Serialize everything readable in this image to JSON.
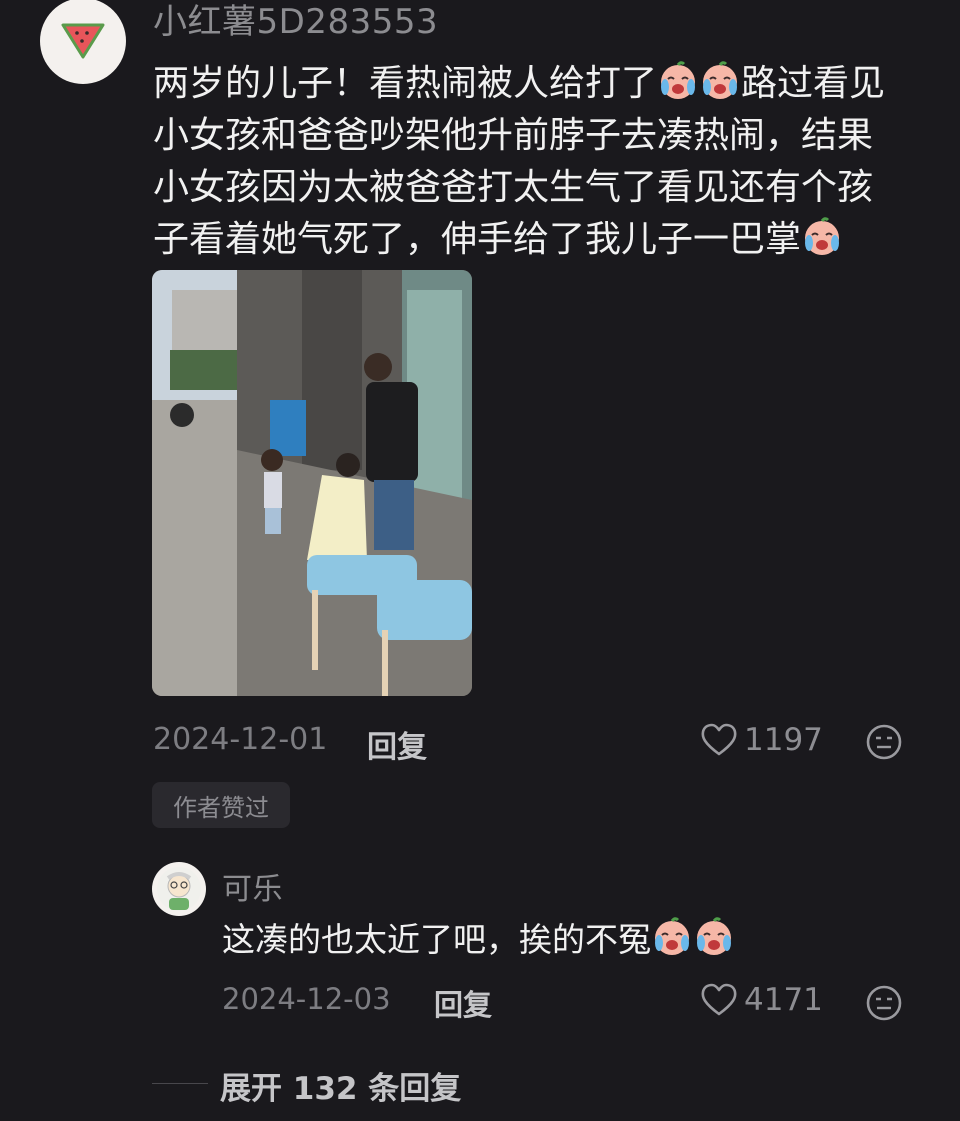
{
  "comment": {
    "username": "小红薯5D283553",
    "lines": [
      "两岁的儿子！看热闹被人给打了",
      "路过看见",
      "小女孩和爸爸吵架他升前脖子去凑热闹，结果",
      "小女孩因为太被爸爸打太生气了看见还有个孩",
      "子看着她气死了，伸手给了我儿子一巴掌"
    ],
    "date": "2024-12-01",
    "reply_label": "回复",
    "likes": "1197",
    "author_liked": "作者赞过"
  },
  "reply": {
    "username": "可乐",
    "text": "这凑的也太近了吧，挨的不冤",
    "date": "2024-12-03",
    "reply_label": "回复",
    "likes": "4171"
  },
  "expand_text": "展开 132 条回复",
  "icons": {
    "avatar_main": "watermelon-icon",
    "emoji": "crying-face-emoji",
    "like": "heart-outline-icon",
    "reaction": "neutral-face-icon"
  },
  "colors": {
    "background": "#1a191d",
    "text": "#f1f1f1",
    "muted": "#8c8c90"
  }
}
